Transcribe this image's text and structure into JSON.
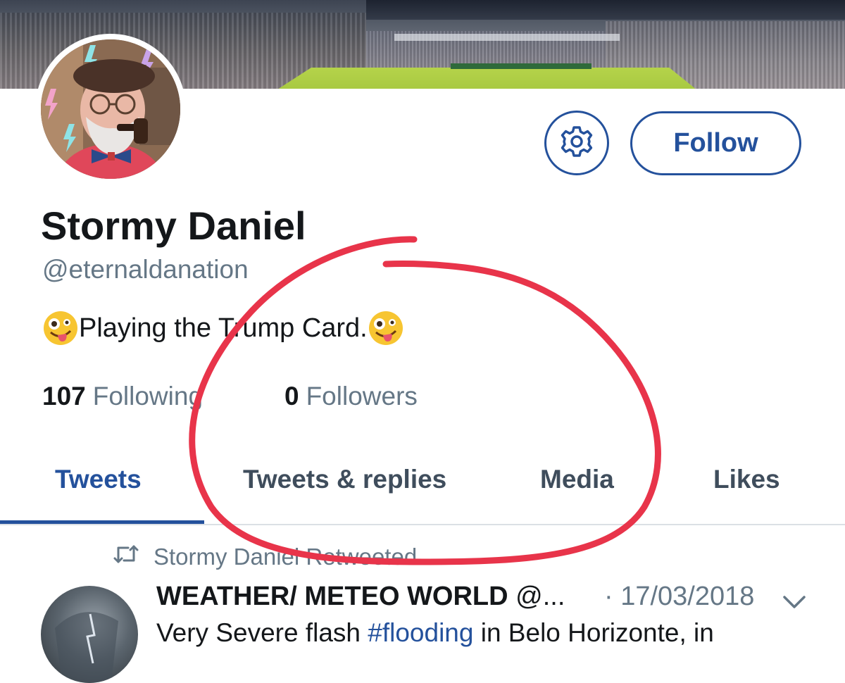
{
  "colors": {
    "accent": "#24519c",
    "secondary_text": "#657786",
    "annotation_red": "#e8344a"
  },
  "profile": {
    "display_name": "Stormy Daniel",
    "handle": "@eternaldanation",
    "bio_text": "Playing the Trump Card.",
    "bio_emoji": "zany-face-emoji",
    "following_count": "107",
    "following_label": "Following",
    "followers_count": "0",
    "followers_label": "Followers"
  },
  "actions": {
    "settings_icon": "gear-icon",
    "follow_label": "Follow"
  },
  "tabs": [
    {
      "label": "Tweets",
      "active": true
    },
    {
      "label": "Tweets & replies",
      "active": false
    },
    {
      "label": "Media",
      "active": false
    },
    {
      "label": "Likes",
      "active": false
    }
  ],
  "tweet": {
    "retweet_icon": "retweet-icon",
    "retweet_text": "Stormy Daniel Retweeted",
    "author_name": "WEATHER/ METEO WORLD",
    "author_handle": "@...",
    "date": "· 17/03/2018",
    "menu_icon": "chevron-down-icon",
    "text_before": "Very Severe flash ",
    "hashtag": "#flooding",
    "text_after": " in Belo Horizonte, in"
  }
}
